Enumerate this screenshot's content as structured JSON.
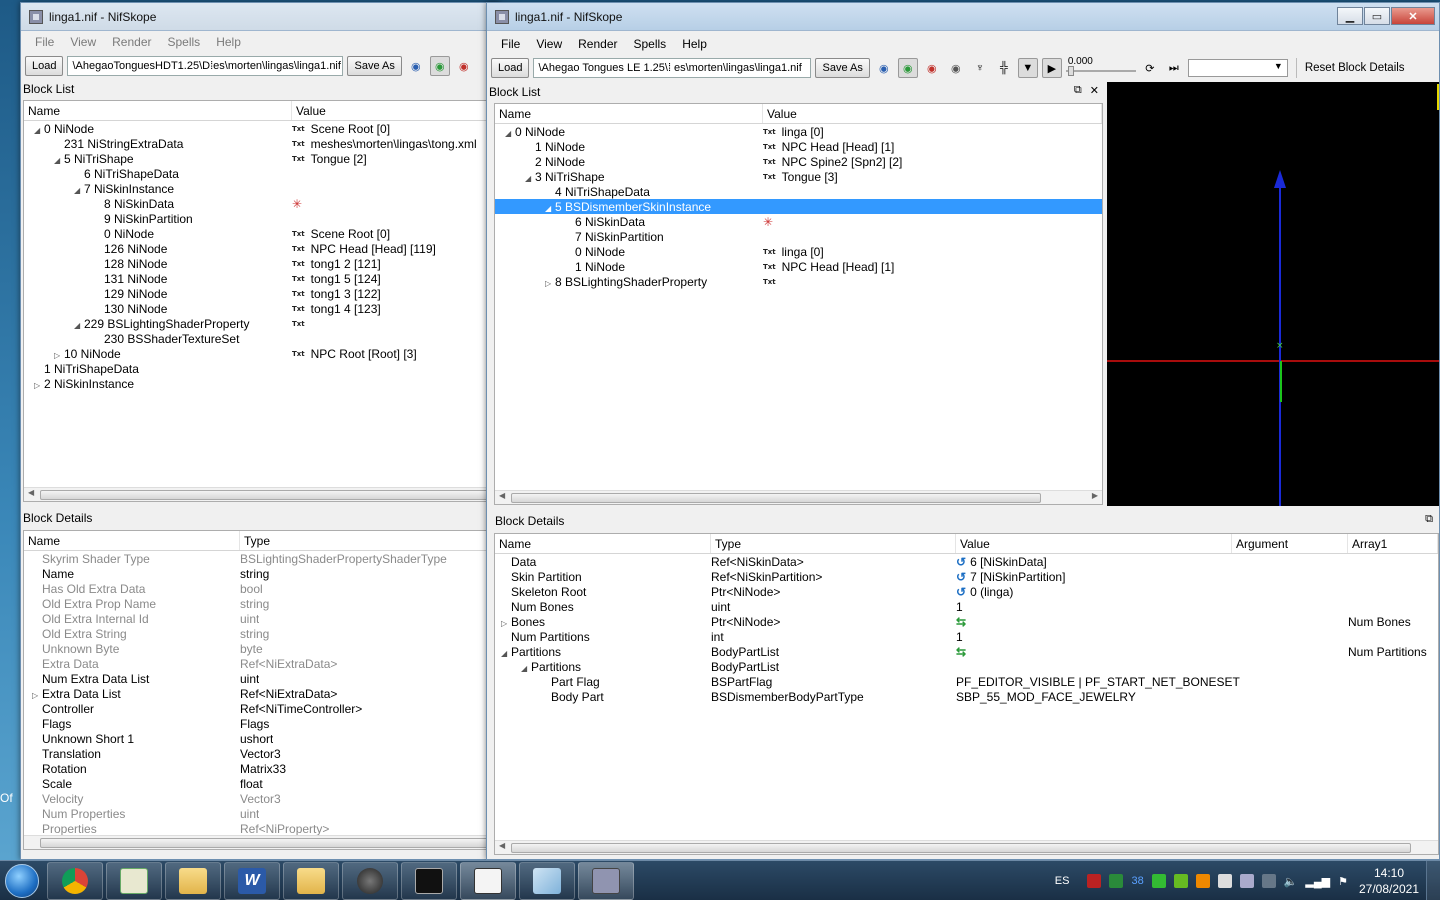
{
  "left_window": {
    "title": "linga1.nif - NifSkope",
    "menu": [
      "File",
      "View",
      "Render",
      "Spells",
      "Help"
    ],
    "load_label": "Load",
    "path_value": "\\AhegaoTonguesHDT1.25\\D",
    "path_value_2": "es\\morten\\lingas\\linga1.nif",
    "save_as_label": "Save As",
    "block_list_title": "Block List",
    "block_list_columns": [
      "Name",
      "Value"
    ],
    "block_list_rows": [
      {
        "name": "0 NiNode",
        "value": "Scene Root [0]",
        "txt": true,
        "arrow": "◢"
      },
      {
        "name": "231 NiStringExtraData",
        "value": "meshes\\morten\\lingas\\tong.xml",
        "txt": true,
        "arrow": ""
      },
      {
        "name": "5 NiTriShape",
        "value": "Tongue [2]",
        "txt": true,
        "arrow": "◢"
      },
      {
        "name": "6 NiTriShapeData",
        "value": "",
        "txt": false,
        "arrow": ""
      },
      {
        "name": "7 NiSkinInstance",
        "value": "",
        "txt": false,
        "arrow": "◢"
      },
      {
        "name": "8 NiSkinData",
        "value": "✳",
        "txt": false,
        "arrow": ""
      },
      {
        "name": "9 NiSkinPartition",
        "value": "",
        "txt": false,
        "arrow": ""
      },
      {
        "name": "0 NiNode",
        "value": "Scene Root [0]",
        "txt": true,
        "arrow": ""
      },
      {
        "name": "126 NiNode",
        "value": "NPC Head [Head] [119]",
        "txt": true,
        "arrow": ""
      },
      {
        "name": "128 NiNode",
        "value": "tong1 2 [121]",
        "txt": true,
        "arrow": ""
      },
      {
        "name": "131 NiNode",
        "value": "tong1 5 [124]",
        "txt": true,
        "arrow": ""
      },
      {
        "name": "129 NiNode",
        "value": "tong1 3 [122]",
        "txt": true,
        "arrow": ""
      },
      {
        "name": "130 NiNode",
        "value": "tong1 4 [123]",
        "txt": true,
        "arrow": ""
      },
      {
        "name": "229 BSLightingShaderProperty",
        "value": "",
        "txt": true,
        "arrow": "◢"
      },
      {
        "name": "230 BSShaderTextureSet",
        "value": "",
        "txt": false,
        "arrow": ""
      },
      {
        "name": "10 NiNode",
        "value": "NPC Root [Root] [3]",
        "txt": true,
        "arrow": "▷"
      },
      {
        "name": "1 NiTriShapeData",
        "value": "",
        "txt": false,
        "arrow": ""
      },
      {
        "name": "2 NiSkinInstance",
        "value": "",
        "txt": false,
        "arrow": "▷"
      }
    ],
    "block_details_title": "Block Details",
    "block_details_columns": [
      "Name",
      "Type"
    ],
    "block_details_rows": [
      {
        "name": "Skyrim Shader Type",
        "type": "BSLightingShaderPropertyShaderType",
        "dim": true,
        "arrow": ""
      },
      {
        "name": "Name",
        "type": "string",
        "dim": false,
        "arrow": ""
      },
      {
        "name": "Has Old Extra Data",
        "type": "bool",
        "dim": true,
        "arrow": ""
      },
      {
        "name": "Old Extra Prop Name",
        "type": "string",
        "dim": true,
        "arrow": ""
      },
      {
        "name": "Old Extra Internal Id",
        "type": "uint",
        "dim": true,
        "arrow": ""
      },
      {
        "name": "Old Extra String",
        "type": "string",
        "dim": true,
        "arrow": ""
      },
      {
        "name": "Unknown Byte",
        "type": "byte",
        "dim": true,
        "arrow": ""
      },
      {
        "name": "Extra Data",
        "type": "Ref<NiExtraData>",
        "dim": true,
        "arrow": ""
      },
      {
        "name": "Num Extra Data List",
        "type": "uint",
        "dim": false,
        "arrow": ""
      },
      {
        "name": "Extra Data List",
        "type": "Ref<NiExtraData>",
        "dim": false,
        "arrow": "▷"
      },
      {
        "name": "Controller",
        "type": "Ref<NiTimeController>",
        "dim": false,
        "arrow": ""
      },
      {
        "name": "Flags",
        "type": "Flags",
        "dim": false,
        "arrow": ""
      },
      {
        "name": "Unknown Short 1",
        "type": "ushort",
        "dim": false,
        "arrow": ""
      },
      {
        "name": "Translation",
        "type": "Vector3",
        "dim": false,
        "arrow": ""
      },
      {
        "name": "Rotation",
        "type": "Matrix33",
        "dim": false,
        "arrow": ""
      },
      {
        "name": "Scale",
        "type": "float",
        "dim": false,
        "arrow": ""
      },
      {
        "name": "Velocity",
        "type": "Vector3",
        "dim": true,
        "arrow": ""
      },
      {
        "name": "Num Properties",
        "type": "uint",
        "dim": true,
        "arrow": ""
      },
      {
        "name": "Properties",
        "type": "Ref<NiProperty>",
        "dim": true,
        "arrow": ""
      }
    ]
  },
  "right_window": {
    "title": "linga1.nif - NifSkope",
    "menu": [
      "File",
      "View",
      "Render",
      "Spells",
      "Help"
    ],
    "load_label": "Load",
    "path_value": "\\Ahegao Tongues LE 1.25\\",
    "path_value_2": "es\\morten\\lingas\\linga1.nif",
    "save_as_label": "Save As",
    "time_value": "0.000",
    "reset_label": "Reset Block Details",
    "block_list_title": "Block List",
    "block_list_columns": [
      "Name",
      "Value"
    ],
    "block_list_rows": [
      {
        "name": "0 NiNode",
        "value": "linga [0]",
        "txt": true,
        "arrow": "◢",
        "selected": false
      },
      {
        "name": "1 NiNode",
        "value": "NPC Head [Head] [1]",
        "txt": true,
        "arrow": "",
        "selected": false
      },
      {
        "name": "2 NiNode",
        "value": "NPC Spine2 [Spn2] [2]",
        "txt": true,
        "arrow": "",
        "selected": false
      },
      {
        "name": "3 NiTriShape",
        "value": "Tongue [3]",
        "txt": true,
        "arrow": "◢",
        "selected": false
      },
      {
        "name": "4 NiTriShapeData",
        "value": "",
        "txt": false,
        "arrow": "",
        "selected": false
      },
      {
        "name": "5 BSDismemberSkinInstance",
        "value": "",
        "txt": false,
        "arrow": "◢",
        "selected": true
      },
      {
        "name": "6 NiSkinData",
        "value": "✳",
        "txt": false,
        "arrow": "",
        "selected": false
      },
      {
        "name": "7 NiSkinPartition",
        "value": "",
        "txt": false,
        "arrow": "",
        "selected": false
      },
      {
        "name": "0 NiNode",
        "value": "linga [0]",
        "txt": true,
        "arrow": "",
        "selected": false
      },
      {
        "name": "1 NiNode",
        "value": "NPC Head [Head] [1]",
        "txt": true,
        "arrow": "",
        "selected": false
      },
      {
        "name": "8 BSLightingShaderProperty",
        "value": "",
        "txt": true,
        "arrow": "▷",
        "selected": false
      }
    ],
    "block_details_title": "Block Details",
    "block_details_columns": [
      "Name",
      "Type",
      "Value",
      "Argument",
      "Array1"
    ],
    "block_details_rows": [
      {
        "name": "Data",
        "type": "Ref<NiSkinData>",
        "value": "6 [NiSkinData]",
        "array1": "",
        "arrow": "",
        "icon": "link"
      },
      {
        "name": "Skin Partition",
        "type": "Ref<NiSkinPartition>",
        "value": "7 [NiSkinPartition]",
        "array1": "",
        "arrow": "",
        "icon": "link"
      },
      {
        "name": "Skeleton Root",
        "type": "Ptr<NiNode>",
        "value": "0 (linga)",
        "array1": "",
        "arrow": "",
        "icon": "link"
      },
      {
        "name": "Num Bones",
        "type": "uint",
        "value": "1",
        "array1": "",
        "arrow": "",
        "icon": ""
      },
      {
        "name": "Bones",
        "type": "Ptr<NiNode>",
        "value": "",
        "array1": "Num Bones",
        "arrow": "▷",
        "icon": "multi"
      },
      {
        "name": "Num Partitions",
        "type": "int",
        "value": "1",
        "array1": "",
        "arrow": "",
        "icon": ""
      },
      {
        "name": "Partitions",
        "type": "BodyPartList",
        "value": "",
        "array1": "Num Partitions",
        "arrow": "◢",
        "icon": "multi"
      },
      {
        "name": "Partitions",
        "type": "BodyPartList",
        "value": "",
        "array1": "",
        "arrow": "◢",
        "icon": ""
      },
      {
        "name": "Part Flag",
        "type": "BSPartFlag",
        "value": "PF_EDITOR_VISIBLE | PF_START_NET_BONESET",
        "array1": "",
        "arrow": "",
        "icon": ""
      },
      {
        "name": "Body Part",
        "type": "BSDismemberBodyPartType",
        "value": "SBP_55_MOD_FACE_JEWELRY",
        "array1": "",
        "arrow": "",
        "icon": ""
      }
    ]
  },
  "desktop_fragment": "Of",
  "taskbar": {
    "language": "ES",
    "tray_number": "38",
    "time": "14:10",
    "date": "27/08/2021"
  }
}
